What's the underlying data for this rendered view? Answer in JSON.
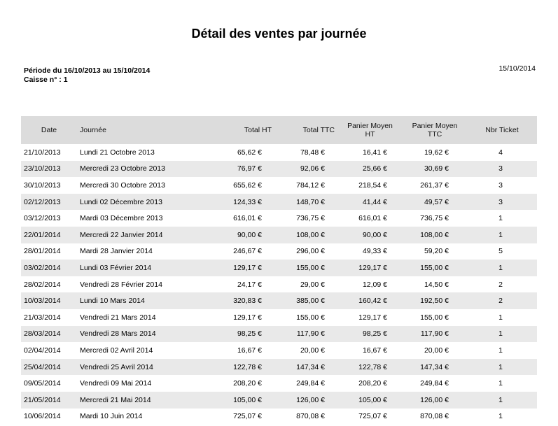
{
  "report": {
    "title": "Détail des ventes par journée",
    "period": "Période du 16/10/2013 au 15/10/2014",
    "register": "Caisse n° : 1",
    "date": "15/10/2014"
  },
  "table": {
    "headers": {
      "date": "Date",
      "day": "Journée",
      "total_ht": "Total HT",
      "total_ttc": "Total TTC",
      "avg_ht_1": "Panier Moyen",
      "avg_ht_2": "HT",
      "avg_ttc_1": "Panier Moyen",
      "avg_ttc_2": "TTC",
      "tickets": "Nbr Ticket"
    },
    "rows": [
      [
        "21/10/2013",
        "Lundi 21 Octobre 2013",
        "65,62 €",
        "78,48 €",
        "16,41 €",
        "19,62 €",
        "4"
      ],
      [
        "23/10/2013",
        "Mercredi 23 Octobre 2013",
        "76,97 €",
        "92,06 €",
        "25,66 €",
        "30,69 €",
        "3"
      ],
      [
        "30/10/2013",
        "Mercredi 30 Octobre 2013",
        "655,62 €",
        "784,12 €",
        "218,54 €",
        "261,37 €",
        "3"
      ],
      [
        "02/12/2013",
        "Lundi 02 Décembre 2013",
        "124,33 €",
        "148,70 €",
        "41,44 €",
        "49,57 €",
        "3"
      ],
      [
        "03/12/2013",
        "Mardi 03 Décembre 2013",
        "616,01 €",
        "736,75 €",
        "616,01 €",
        "736,75 €",
        "1"
      ],
      [
        "22/01/2014",
        "Mercredi 22 Janvier 2014",
        "90,00 €",
        "108,00 €",
        "90,00 €",
        "108,00 €",
        "1"
      ],
      [
        "28/01/2014",
        "Mardi 28 Janvier 2014",
        "246,67 €",
        "296,00 €",
        "49,33 €",
        "59,20 €",
        "5"
      ],
      [
        "03/02/2014",
        "Lundi 03 Février 2014",
        "129,17 €",
        "155,00 €",
        "129,17 €",
        "155,00 €",
        "1"
      ],
      [
        "28/02/2014",
        "Vendredi 28 Février 2014",
        "24,17 €",
        "29,00 €",
        "12,09 €",
        "14,50 €",
        "2"
      ],
      [
        "10/03/2014",
        "Lundi 10 Mars 2014",
        "320,83 €",
        "385,00 €",
        "160,42 €",
        "192,50 €",
        "2"
      ],
      [
        "21/03/2014",
        "Vendredi 21 Mars 2014",
        "129,17 €",
        "155,00 €",
        "129,17 €",
        "155,00 €",
        "1"
      ],
      [
        "28/03/2014",
        "Vendredi 28 Mars 2014",
        "98,25 €",
        "117,90 €",
        "98,25 €",
        "117,90 €",
        "1"
      ],
      [
        "02/04/2014",
        "Mercredi 02 Avril 2014",
        "16,67 €",
        "20,00 €",
        "16,67 €",
        "20,00 €",
        "1"
      ],
      [
        "25/04/2014",
        "Vendredi 25 Avril 2014",
        "122,78 €",
        "147,34 €",
        "122,78 €",
        "147,34 €",
        "1"
      ],
      [
        "09/05/2014",
        "Vendredi 09 Mai 2014",
        "208,20 €",
        "249,84 €",
        "208,20 €",
        "249,84 €",
        "1"
      ],
      [
        "21/05/2014",
        "Mercredi 21 Mai 2014",
        "105,00 €",
        "126,00 €",
        "105,00 €",
        "126,00 €",
        "1"
      ],
      [
        "10/06/2014",
        "Mardi 10 Juin 2014",
        "725,07 €",
        "870,08 €",
        "725,07 €",
        "870,08 €",
        "1"
      ]
    ]
  }
}
